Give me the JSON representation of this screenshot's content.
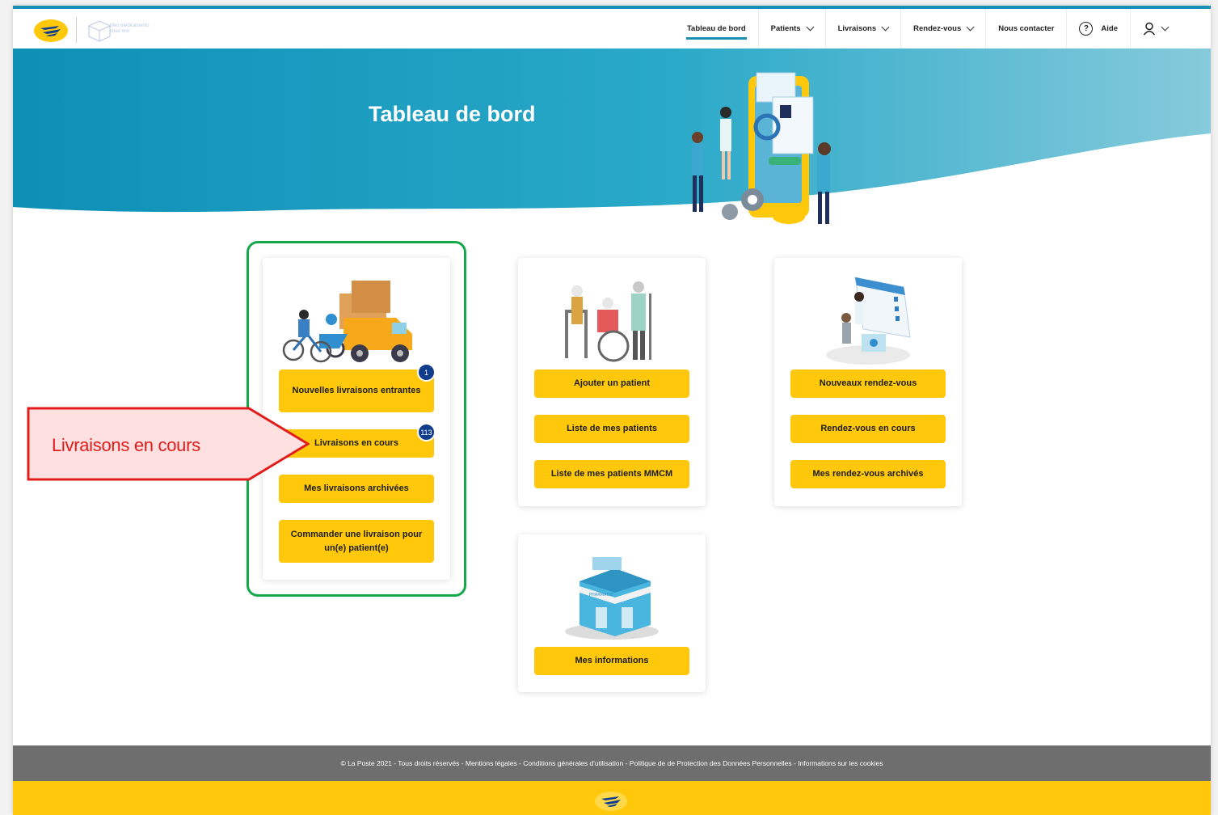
{
  "nav": {
    "items": [
      "Tableau de bord",
      "Patients",
      "Livraisons",
      "Rendez-vous",
      "Nous contacter"
    ],
    "help_label": "Aide",
    "help_symbol": "?"
  },
  "logo": {
    "mmcm_line1": "Mes médicaments",
    "mmcm_line2": "chez moi"
  },
  "hero": {
    "title": "Tableau de bord"
  },
  "cards": {
    "livraisons": {
      "buttons": [
        {
          "label": "Nouvelles livraisons entrantes",
          "badge": "1"
        },
        {
          "label": "Livraisons en cours",
          "badge": "113"
        },
        {
          "label": "Mes livraisons archivées"
        },
        {
          "label": "Commander une livraison pour un(e) patient(e)"
        }
      ]
    },
    "patients": {
      "buttons": [
        "Ajouter un patient",
        "Liste de mes patients",
        "Liste de mes patients MMCM"
      ]
    },
    "rendezvous": {
      "buttons": [
        "Nouveaux rendez-vous",
        "Rendez-vous en cours",
        "Mes rendez-vous archivés"
      ]
    },
    "informations": {
      "buttons": [
        "Mes informations"
      ],
      "shop_sign": "PHARMACIE"
    }
  },
  "callout": {
    "text": "Livraisons en cours"
  },
  "footer": {
    "text": "© La Poste 2021 - Tous droits réservés - Mentions légales - Conditions générales d'utilisation - Politique de de Protection des Données Personnelles - Informations sur les cookies"
  },
  "colors": {
    "yellow": "#ffc80a",
    "teal": "#1a8fb3",
    "badge": "#0f3d8c",
    "highlight_green": "#13a84a",
    "callout_red": "#e21b1b"
  }
}
